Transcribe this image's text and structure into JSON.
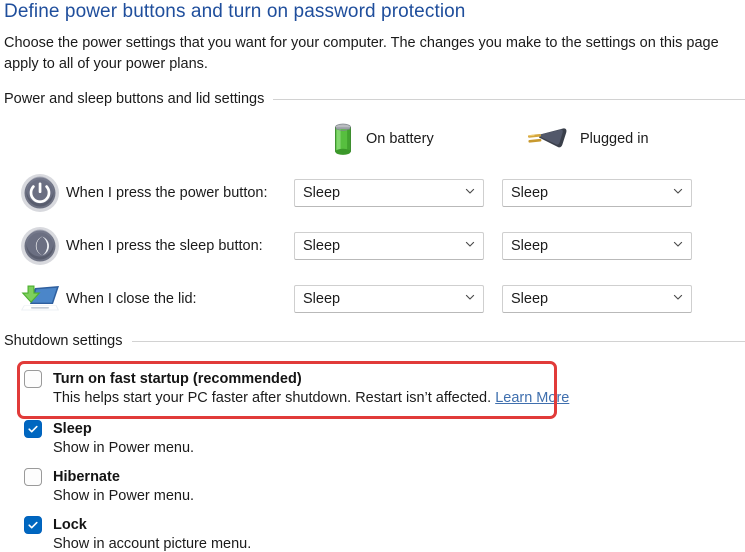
{
  "page": {
    "title": "Define power buttons and turn on password protection",
    "description": "Choose the power settings that you want for your computer. The changes you make to the settings on this page apply to all of your power plans."
  },
  "sections": {
    "power": {
      "label": "Power and sleep buttons and lid settings"
    },
    "shutdown": {
      "label": "Shutdown settings"
    }
  },
  "columns": {
    "battery": {
      "label": "On battery",
      "icon": "battery-icon"
    },
    "plugged": {
      "label": "Plugged in",
      "icon": "power-plug-icon"
    }
  },
  "rows": [
    {
      "icon": "power-button-icon",
      "label": "When I press the power button:",
      "battery_value": "Sleep",
      "plugged_value": "Sleep"
    },
    {
      "icon": "sleep-moon-icon",
      "label": "When I press the sleep button:",
      "battery_value": "Sleep",
      "plugged_value": "Sleep"
    },
    {
      "icon": "laptop-lid-icon",
      "label": "When I close the lid:",
      "battery_value": "Sleep",
      "plugged_value": "Sleep"
    }
  ],
  "shutdown_items": [
    {
      "title": "Turn on fast startup (recommended)",
      "checked": false,
      "description": "This helps start your PC faster after shutdown. Restart isn’t affected. ",
      "link": "Learn More",
      "highlighted": true
    },
    {
      "title": "Sleep",
      "checked": true,
      "description": "Show in Power menu.",
      "link": "",
      "highlighted": false
    },
    {
      "title": "Hibernate",
      "checked": false,
      "description": "Show in Power menu.",
      "link": "",
      "highlighted": false
    },
    {
      "title": "Lock",
      "checked": true,
      "description": "Show in account picture menu.",
      "link": "",
      "highlighted": false
    }
  ],
  "colors": {
    "title_blue": "#1f4e9c",
    "link_blue": "#3f6fae",
    "checkbox_blue": "#0067c0",
    "annotation_red": "#e13b39",
    "battery_green": "#5cc24a",
    "rule_gray": "#d2d2d2"
  }
}
